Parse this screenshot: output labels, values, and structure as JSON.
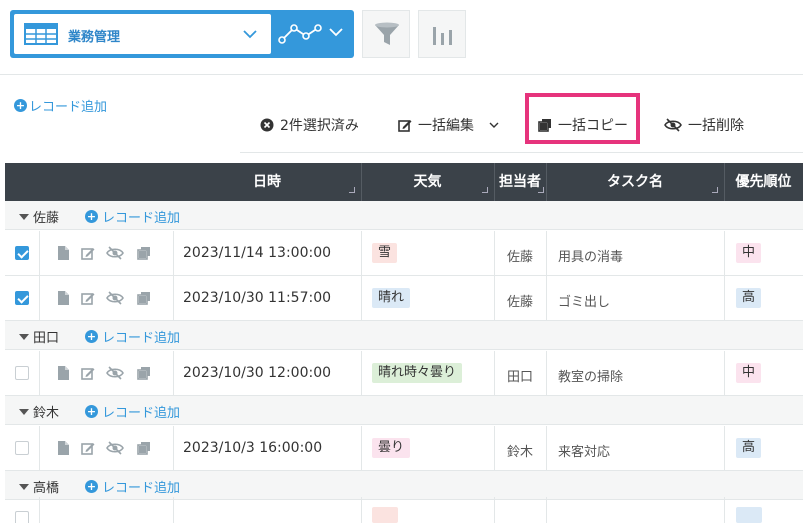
{
  "toolbar": {
    "view_name": "業務管理",
    "colors": {
      "accent": "#3498db",
      "highlight": "#e6337c",
      "header_bg": "#3b4249"
    }
  },
  "add_record_label": "レコード追加",
  "bulk_actions": {
    "selected": "2件選択済み",
    "edit": "一括編集",
    "copy": "一括コピー",
    "delete": "一括削除"
  },
  "columns": {
    "datetime": "日時",
    "weather": "天気",
    "assignee": "担当者",
    "task": "タスク名",
    "priority": "優先順位"
  },
  "groups": [
    {
      "name": "佐藤",
      "add_label": "レコード追加",
      "rows": [
        {
          "checked": true,
          "datetime": "2023/11/14 13:00:00",
          "weather": "雪",
          "weather_color": "#fbe3e0",
          "assignee": "佐藤",
          "task": "用具の消毒",
          "priority": "中",
          "priority_color": "#fbe3ee"
        },
        {
          "checked": true,
          "datetime": "2023/10/30 11:57:00",
          "weather": "晴れ",
          "weather_color": "#dbe9f6",
          "assignee": "佐藤",
          "task": "ゴミ出し",
          "priority": "高",
          "priority_color": "#dbe9f6"
        }
      ]
    },
    {
      "name": "田口",
      "add_label": "レコード追加",
      "rows": [
        {
          "checked": false,
          "datetime": "2023/10/30 12:00:00",
          "weather": "晴れ時々曇り",
          "weather_color": "#dcefd8",
          "assignee": "田口",
          "task": "教室の掃除",
          "priority": "中",
          "priority_color": "#fbe3ee"
        }
      ]
    },
    {
      "name": "鈴木",
      "add_label": "レコード追加",
      "rows": [
        {
          "checked": false,
          "datetime": "2023/10/3 16:00:00",
          "weather": "曇り",
          "weather_color": "#fbe3ee",
          "assignee": "鈴木",
          "task": "来客対応",
          "priority": "高",
          "priority_color": "#dbe9f6"
        }
      ]
    },
    {
      "name": "高橋",
      "add_label": "レコード追加",
      "rows": []
    }
  ]
}
